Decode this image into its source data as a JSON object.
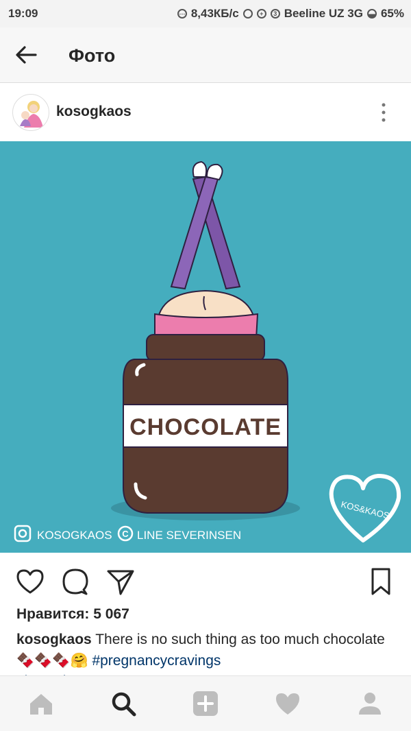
{
  "status_bar": {
    "time": "19:09",
    "speed": "8,43КБ/с",
    "sim_number": "3",
    "carrier": "Beeline UZ 3G",
    "battery": "65%"
  },
  "app_bar": {
    "title": "Фото",
    "back_icon": "arrow-left-icon"
  },
  "post": {
    "username": "kosogkaos",
    "photo": {
      "jar_label": "CHOCOLATE",
      "credit_instagram": "KOSOGKAOS",
      "credit_copyright": "LINE SEVERINSEN",
      "logo_text": "KOS&KAOS",
      "background_color": "#45adbe"
    },
    "likes_label": "Нравится: 5 067",
    "caption": {
      "username": "kosogkaos",
      "text": "There is no such thing as too much chocolate",
      "emojis": "🍫🍫🍫🤗",
      "hashtag": "#pregnancycravings",
      "cut_text": "#kosogkaos"
    }
  },
  "bottom_nav": [
    "home-icon",
    "search-icon",
    "add-icon",
    "heart-icon",
    "profile-icon"
  ],
  "colors": {
    "accent_link": "#003569",
    "legs": "#7d56a8",
    "pants": "#ec7dad",
    "jar": "#5a3b30"
  }
}
